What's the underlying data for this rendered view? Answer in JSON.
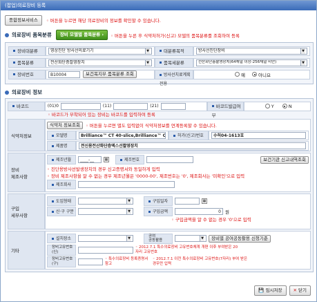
{
  "window": {
    "title": "(팝업)의료장비 등록"
  },
  "top": {
    "service_btn": "종합정보서비스",
    "note": "◦ 버튼을 누르면 해당 의료장비의 정보를 확인할 수 있습니다."
  },
  "section1": {
    "title": "의료장비 품목분류",
    "model_btn": "장비 모델별 품목분류 ›",
    "note": "◦ 버튼을 누른 후 식약처허가(신고) 모델의 품목분류를 조회하여 등록",
    "type_label": "장비대분류",
    "type_value": "영상진단 방사선의료기기",
    "class_label": "대분류목적",
    "class_value": "방사선진단장비",
    "item_label": "품목분류",
    "item_value": "전산화단층촬영장치",
    "item2_label": "품목세분류",
    "item2_value": "전산화단층촬영장치(64채널 이상-256채널 미만)",
    "code_label": "장비번호",
    "code_value": "B10004",
    "code_btn": "보건복지부 품목분류 조회",
    "rad_label": "방사선치료계획전용",
    "yes": "예",
    "no": "아니요"
  },
  "section2": {
    "title": "의료장비 정보",
    "barcode_label": "바코드",
    "bc1": "(01)0",
    "bc2": "(11)",
    "bc3": "(21)",
    "bc_flag_label": "바코드발급여부",
    "y": "Y",
    "n": "N",
    "bc_note": "◦ 바코드가 부착되어 있는 장비는 바코드를 입력하여 등록",
    "mfds_label": "식약처정보",
    "mfds_btn": "식약처 정보조회",
    "mfds_note": "◦ 버튼을 누르면 별도 입력없이 식약처정보를 연계등록할 수 있습니다.",
    "model_label": "모델명",
    "model_value": "Brilliance™ CT 40-slice,Brilliance™ CT 64-s",
    "permit_label": "허가(신고)번호",
    "permit_value": "수허04-1613호",
    "product_label": "제품명",
    "product_value": "전신용전산화단층엑스선촬영장치",
    "mfr_label": "장비\n제조사항",
    "mfr_date_label": "제조년월",
    "mfr_date_value": "____-__",
    "mfr_no_label": "제조번호",
    "mfr_btn": "보건기관 신고내역조회",
    "mfr_note1": "◦ 진단용방사선발생장치의 경우 신고증명서와 동일하게 입력",
    "mfr_note2": "◦ 장비 제조사항을 알 수 없는 경우 제조년월은 '0000-00', 제조번호는 '0', 제조회사는 '미확인'으로 입력",
    "maker_label": "제조회사",
    "buy_label": "구입\n세부사항",
    "import_label": "도입형태",
    "buy_date_label": "구입일자",
    "newused_label": "신·구 구분",
    "price_label": "구입금액",
    "price_value": "0",
    "won": "원",
    "price_note": "◦ 구입금액을 알 수 없는 경우 '0'으로 입력",
    "etc_label": "기타",
    "place_label": "설치장소",
    "common_label": "공여\n공동활용",
    "common_btn": "장비별 공여공동활용 신청기준",
    "uid1_label": "장비고유번호(신)",
    "uid1_note": "◦ 2012.7.1 특수의료장비 고유번호체계 개편 이후 부여받은 20자리 고유번호",
    "uid2_label": "장비고유번호(구)",
    "uid2_note1": "◦ 특수의료장비 등록증명서 참고",
    "uid2_note2": "◦ 2012.7.1 이전 특수의료장비 고유번호(7자리) 부여 받은 경우만 입력"
  },
  "footer": {
    "save": "임시저장",
    "close": "닫기"
  }
}
